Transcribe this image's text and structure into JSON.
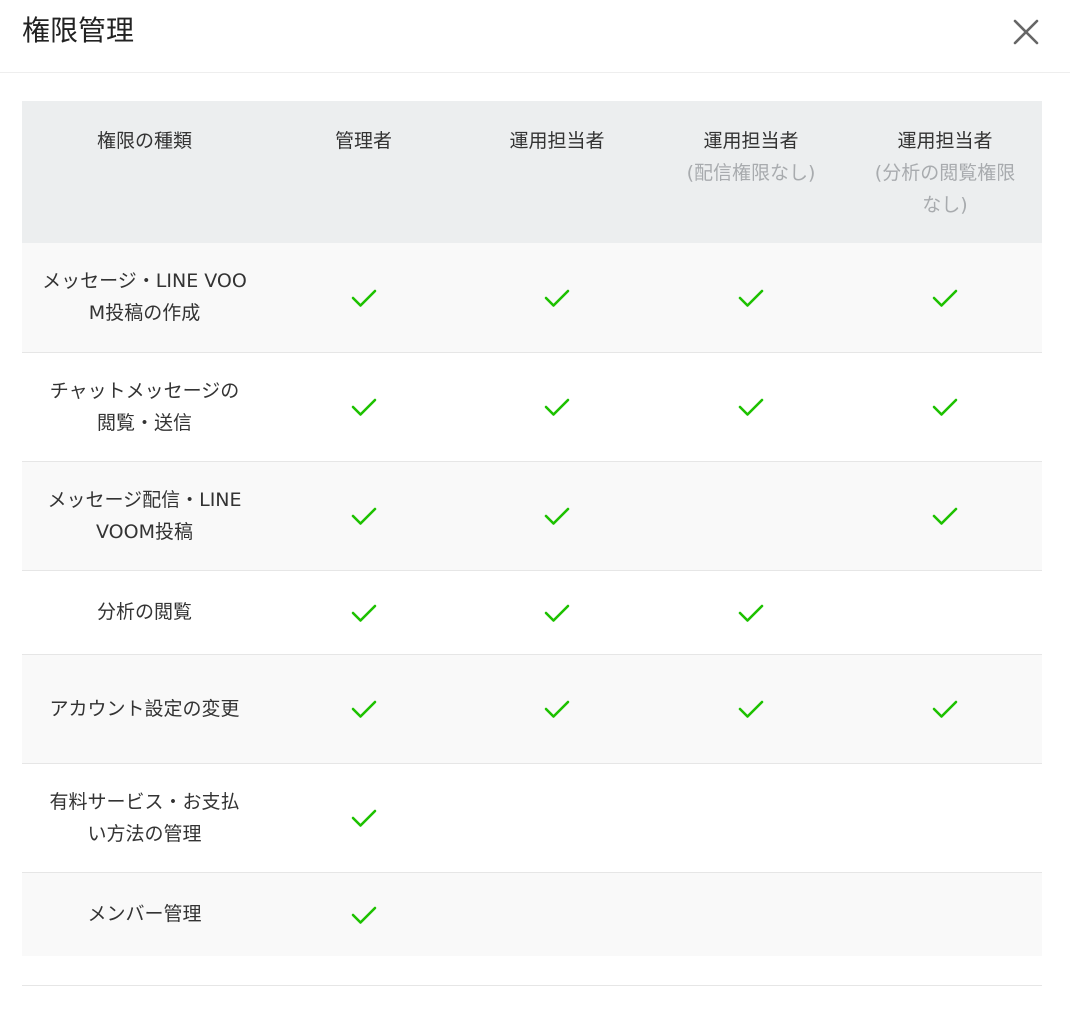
{
  "modal": {
    "title": "権限管理",
    "close_icon": "close-icon"
  },
  "table": {
    "headers": [
      {
        "label": "権限の種類",
        "sub": ""
      },
      {
        "label": "管理者",
        "sub": ""
      },
      {
        "label": "運用担当者",
        "sub": ""
      },
      {
        "label": "運用担当者",
        "sub": "(配信権限なし)"
      },
      {
        "label": "運用担当者",
        "sub": "(分析の閲覧権限なし)"
      }
    ],
    "rows": [
      {
        "label": "メッセージ・LINE VOOM投稿の作成",
        "checks": [
          true,
          true,
          true,
          true
        ],
        "height": 109
      },
      {
        "label": "チャットメッセージの閲覧・送信",
        "checks": [
          true,
          true,
          true,
          true
        ],
        "height": 109
      },
      {
        "label": "メッセージ配信・LINE VOOM投稿",
        "checks": [
          true,
          true,
          false,
          true
        ],
        "height": 109
      },
      {
        "label": "分析の閲覧",
        "checks": [
          true,
          true,
          true,
          false
        ],
        "height": 84
      },
      {
        "label": "アカウント設定の変更",
        "checks": [
          true,
          true,
          true,
          true
        ],
        "height": 109
      },
      {
        "label": "有料サービス・お支払い方法の管理",
        "checks": [
          true,
          false,
          false,
          false
        ],
        "height": 109
      },
      {
        "label": "メンバー管理",
        "checks": [
          true,
          false,
          false,
          false
        ],
        "height": 84
      }
    ],
    "check_icon": "check-icon",
    "check_color": "#1dc100"
  }
}
